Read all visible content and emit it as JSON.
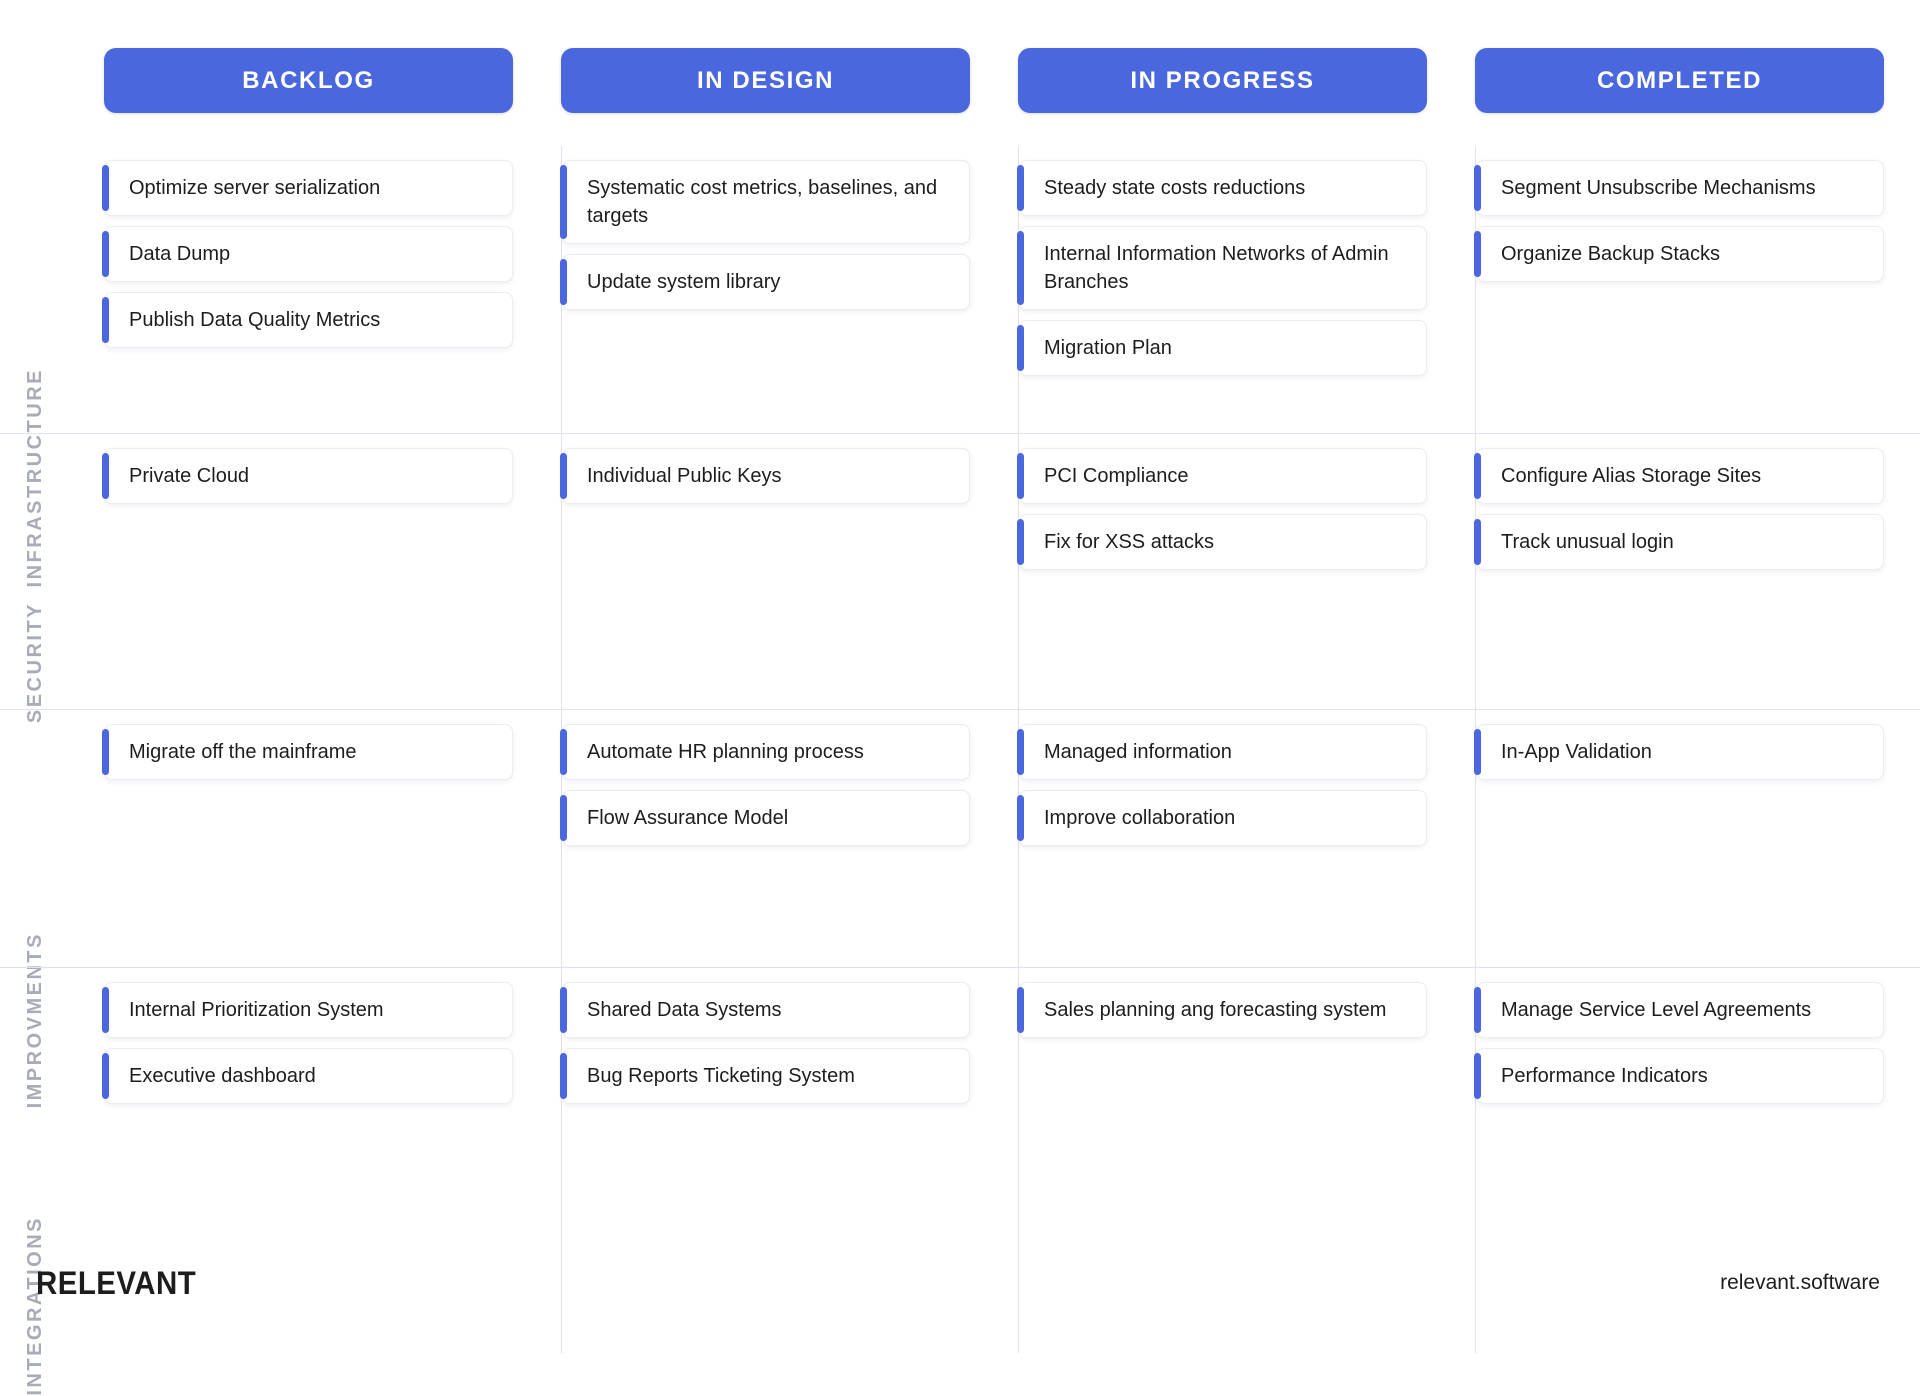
{
  "columns": [
    {
      "id": "backlog",
      "label": "BACKLOG"
    },
    {
      "id": "in-design",
      "label": "IN DESIGN"
    },
    {
      "id": "in-progress",
      "label": "IN PROGRESS"
    },
    {
      "id": "completed",
      "label": "COMPLETED"
    }
  ],
  "rows": [
    {
      "id": "infrastructure",
      "label": "INFRASTRUCTURE",
      "cells": [
        [
          "Optimize server serialization",
          "Data Dump",
          "Publish Data Quality Metrics"
        ],
        [
          "Systematic cost metrics, baselines, and targets",
          "Update system library"
        ],
        [
          "Steady state costs reductions",
          "Internal Information Networks of Admin Branches",
          "Migration Plan"
        ],
        [
          "Segment Unsubscribe Mechanisms",
          "Organize Backup Stacks"
        ]
      ]
    },
    {
      "id": "security",
      "label": "SECURITY",
      "cells": [
        [
          "Private Cloud"
        ],
        [
          "Individual Public Keys"
        ],
        [
          "PCI Compliance",
          "Fix for XSS attacks"
        ],
        [
          "Configure Alias Storage Sites",
          "Track unusual login"
        ]
      ]
    },
    {
      "id": "improvements",
      "label": "IMPROVMENTS",
      "cells": [
        [
          "Migrate off the mainframe"
        ],
        [
          "Automate HR planning process",
          "Flow Assurance Model"
        ],
        [
          "Managed information",
          "Improve collaboration"
        ],
        [
          "In-App Validation"
        ]
      ]
    },
    {
      "id": "integrations",
      "label": "INTEGRATIONS",
      "cells": [
        [
          "Internal Prioritization System",
          "Executive dashboard"
        ],
        [
          "Shared Data Systems",
          "Bug Reports Ticketing System"
        ],
        [
          "Sales planning ang forecasting system"
        ],
        [
          "Manage Service Level Agreements",
          "Performance Indicators"
        ]
      ]
    }
  ],
  "footer": {
    "brand": "RELEVANT",
    "site": "relevant.software"
  },
  "colors": {
    "accent": "#4a67dd",
    "header_text": "#ffffff",
    "row_label": "#a8abb8",
    "card_text": "#1d1d1f",
    "divider": "#dfe2ef",
    "card_border": "#ececf1",
    "background": "#ffffff"
  }
}
